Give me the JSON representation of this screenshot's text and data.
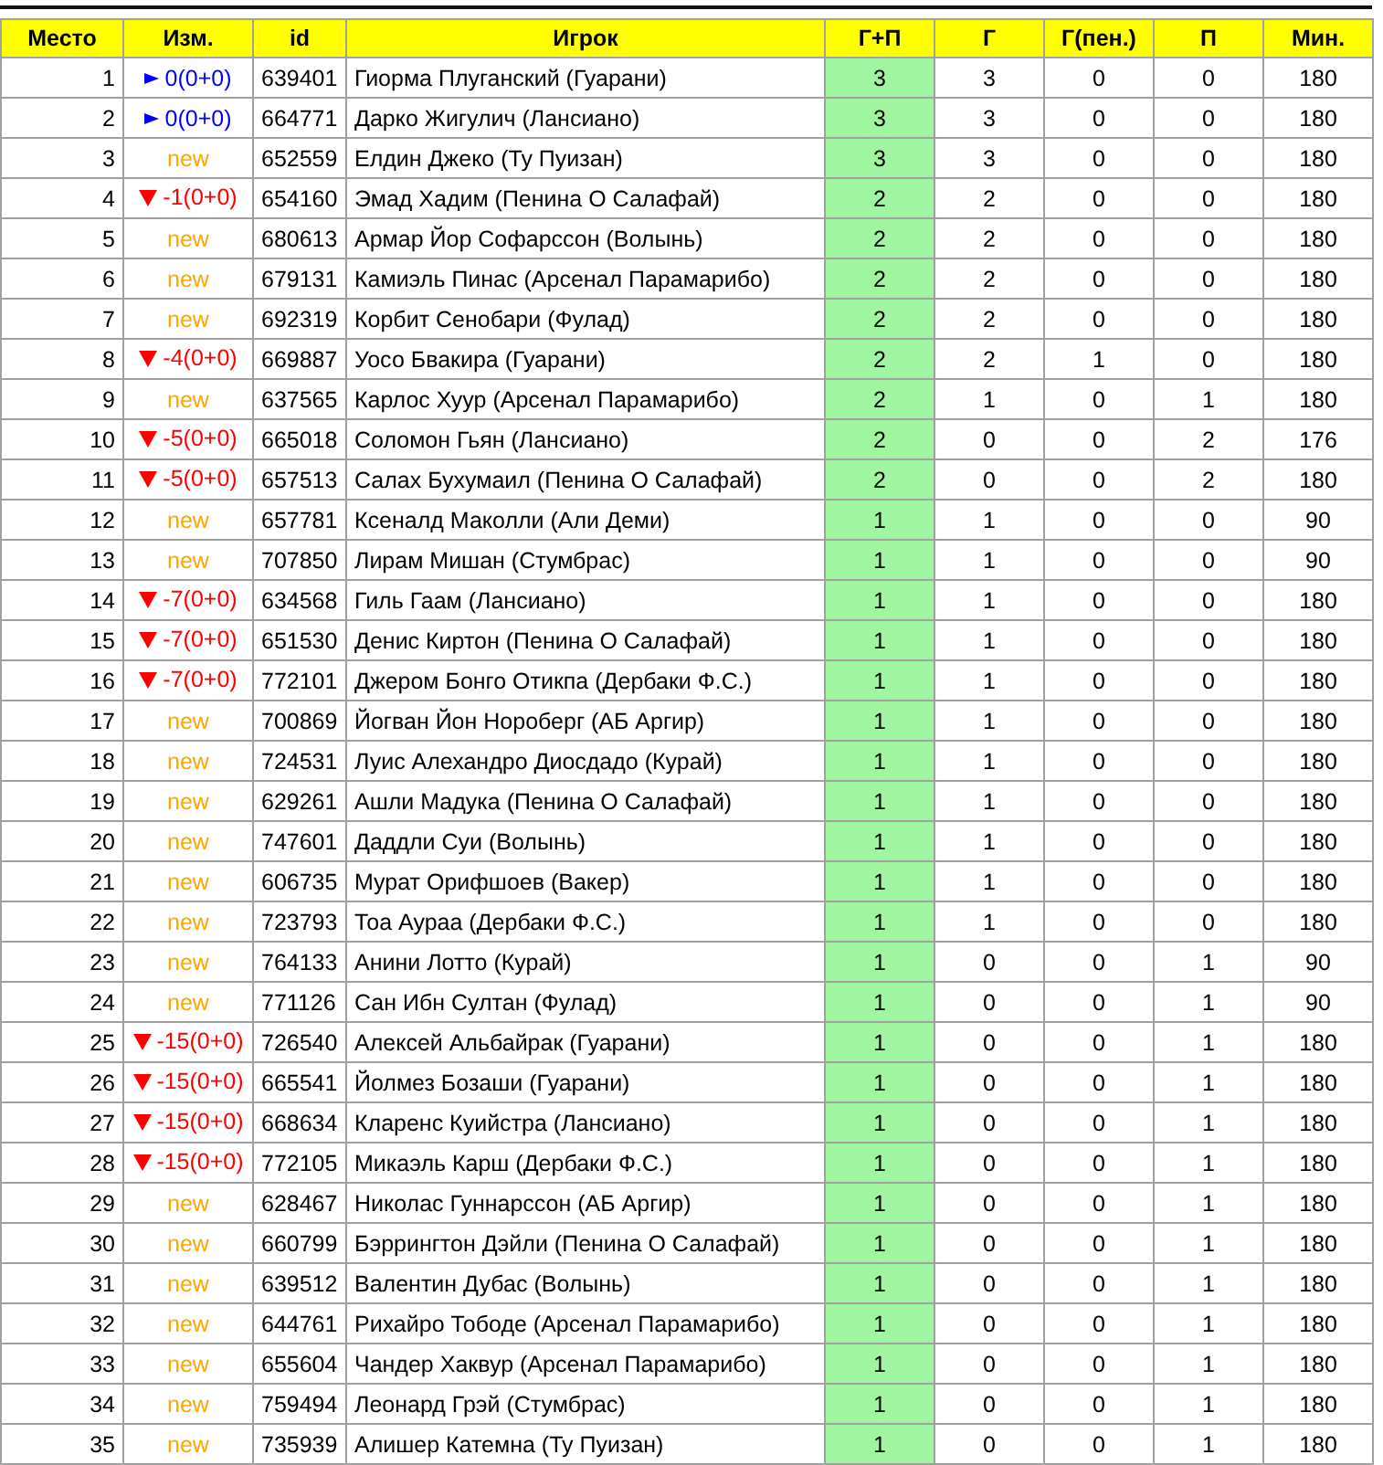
{
  "table": {
    "columns": [
      "Место",
      "Изм.",
      "id",
      "Игрок",
      "Г+П",
      "Г",
      "Г(пен.)",
      "П",
      "Мин."
    ],
    "rows": [
      {
        "place": "1",
        "change": {
          "kind": "same",
          "text": "0(0+0)"
        },
        "id": "639401",
        "player": "Гиорма Плуганский (Гуарани)",
        "gp": "3",
        "g": "3",
        "gpen": "0",
        "p": "0",
        "min": "180"
      },
      {
        "place": "2",
        "change": {
          "kind": "same",
          "text": "0(0+0)"
        },
        "id": "664771",
        "player": "Дарко Жигулич (Лансиано)",
        "gp": "3",
        "g": "3",
        "gpen": "0",
        "p": "0",
        "min": "180"
      },
      {
        "place": "3",
        "change": {
          "kind": "new",
          "text": "new"
        },
        "id": "652559",
        "player": "Елдин Джеко (Ту Пуизан)",
        "gp": "3",
        "g": "3",
        "gpen": "0",
        "p": "0",
        "min": "180"
      },
      {
        "place": "4",
        "change": {
          "kind": "down",
          "text": "-1(0+0)"
        },
        "id": "654160",
        "player": "Эмад Хадим (Пенина О Салафай)",
        "gp": "2",
        "g": "2",
        "gpen": "0",
        "p": "0",
        "min": "180"
      },
      {
        "place": "5",
        "change": {
          "kind": "new",
          "text": "new"
        },
        "id": "680613",
        "player": "Армар Йор Софарссон (Волынь)",
        "gp": "2",
        "g": "2",
        "gpen": "0",
        "p": "0",
        "min": "180"
      },
      {
        "place": "6",
        "change": {
          "kind": "new",
          "text": "new"
        },
        "id": "679131",
        "player": "Камиэль Пинас (Арсенал Парамарибо)",
        "gp": "2",
        "g": "2",
        "gpen": "0",
        "p": "0",
        "min": "180"
      },
      {
        "place": "7",
        "change": {
          "kind": "new",
          "text": "new"
        },
        "id": "692319",
        "player": "Корбит Сенобари (Фулад)",
        "gp": "2",
        "g": "2",
        "gpen": "0",
        "p": "0",
        "min": "180"
      },
      {
        "place": "8",
        "change": {
          "kind": "down",
          "text": "-4(0+0)"
        },
        "id": "669887",
        "player": "Уосо Бвакира (Гуарани)",
        "gp": "2",
        "g": "2",
        "gpen": "1",
        "p": "0",
        "min": "180"
      },
      {
        "place": "9",
        "change": {
          "kind": "new",
          "text": "new"
        },
        "id": "637565",
        "player": "Карлос Хуур (Арсенал Парамарибо)",
        "gp": "2",
        "g": "1",
        "gpen": "0",
        "p": "1",
        "min": "180"
      },
      {
        "place": "10",
        "change": {
          "kind": "down",
          "text": "-5(0+0)"
        },
        "id": "665018",
        "player": "Соломон Гьян (Лансиано)",
        "gp": "2",
        "g": "0",
        "gpen": "0",
        "p": "2",
        "min": "176"
      },
      {
        "place": "11",
        "change": {
          "kind": "down",
          "text": "-5(0+0)"
        },
        "id": "657513",
        "player": "Салах Бухумаил (Пенина О Салафай)",
        "gp": "2",
        "g": "0",
        "gpen": "0",
        "p": "2",
        "min": "180"
      },
      {
        "place": "12",
        "change": {
          "kind": "new",
          "text": "new"
        },
        "id": "657781",
        "player": "Ксеналд Маколли (Али Деми)",
        "gp": "1",
        "g": "1",
        "gpen": "0",
        "p": "0",
        "min": "90"
      },
      {
        "place": "13",
        "change": {
          "kind": "new",
          "text": "new"
        },
        "id": "707850",
        "player": "Лирам Мишан (Стумбрас)",
        "gp": "1",
        "g": "1",
        "gpen": "0",
        "p": "0",
        "min": "90"
      },
      {
        "place": "14",
        "change": {
          "kind": "down",
          "text": "-7(0+0)"
        },
        "id": "634568",
        "player": "Гиль Гаам (Лансиано)",
        "gp": "1",
        "g": "1",
        "gpen": "0",
        "p": "0",
        "min": "180"
      },
      {
        "place": "15",
        "change": {
          "kind": "down",
          "text": "-7(0+0)"
        },
        "id": "651530",
        "player": "Денис Киртон (Пенина О Салафай)",
        "gp": "1",
        "g": "1",
        "gpen": "0",
        "p": "0",
        "min": "180"
      },
      {
        "place": "16",
        "change": {
          "kind": "down",
          "text": "-7(0+0)"
        },
        "id": "772101",
        "player": "Джером Бонго Отикпа (Дербаки Ф.С.)",
        "gp": "1",
        "g": "1",
        "gpen": "0",
        "p": "0",
        "min": "180"
      },
      {
        "place": "17",
        "change": {
          "kind": "new",
          "text": "new"
        },
        "id": "700869",
        "player": "Йогван Йон Нороберг (АБ Аргир)",
        "gp": "1",
        "g": "1",
        "gpen": "0",
        "p": "0",
        "min": "180"
      },
      {
        "place": "18",
        "change": {
          "kind": "new",
          "text": "new"
        },
        "id": "724531",
        "player": "Луис Алехандро Диосдадо (Курай)",
        "gp": "1",
        "g": "1",
        "gpen": "0",
        "p": "0",
        "min": "180"
      },
      {
        "place": "19",
        "change": {
          "kind": "new",
          "text": "new"
        },
        "id": "629261",
        "player": "Ашли Мадука (Пенина О Салафай)",
        "gp": "1",
        "g": "1",
        "gpen": "0",
        "p": "0",
        "min": "180"
      },
      {
        "place": "20",
        "change": {
          "kind": "new",
          "text": "new"
        },
        "id": "747601",
        "player": "Даддли Суи (Волынь)",
        "gp": "1",
        "g": "1",
        "gpen": "0",
        "p": "0",
        "min": "180"
      },
      {
        "place": "21",
        "change": {
          "kind": "new",
          "text": "new"
        },
        "id": "606735",
        "player": "Мурат Орифшоев (Вакер)",
        "gp": "1",
        "g": "1",
        "gpen": "0",
        "p": "0",
        "min": "180"
      },
      {
        "place": "22",
        "change": {
          "kind": "new",
          "text": "new"
        },
        "id": "723793",
        "player": "Тоа Аураа (Дербаки Ф.С.)",
        "gp": "1",
        "g": "1",
        "gpen": "0",
        "p": "0",
        "min": "180"
      },
      {
        "place": "23",
        "change": {
          "kind": "new",
          "text": "new"
        },
        "id": "764133",
        "player": "Анини Лотто (Курай)",
        "gp": "1",
        "g": "0",
        "gpen": "0",
        "p": "1",
        "min": "90"
      },
      {
        "place": "24",
        "change": {
          "kind": "new",
          "text": "new"
        },
        "id": "771126",
        "player": "Сан Ибн Султан (Фулад)",
        "gp": "1",
        "g": "0",
        "gpen": "0",
        "p": "1",
        "min": "90"
      },
      {
        "place": "25",
        "change": {
          "kind": "down",
          "text": "-15(0+0)"
        },
        "id": "726540",
        "player": "Алексей Альбайрак (Гуарани)",
        "gp": "1",
        "g": "0",
        "gpen": "0",
        "p": "1",
        "min": "180"
      },
      {
        "place": "26",
        "change": {
          "kind": "down",
          "text": "-15(0+0)"
        },
        "id": "665541",
        "player": "Йолмез Бозаши (Гуарани)",
        "gp": "1",
        "g": "0",
        "gpen": "0",
        "p": "1",
        "min": "180"
      },
      {
        "place": "27",
        "change": {
          "kind": "down",
          "text": "-15(0+0)"
        },
        "id": "668634",
        "player": "Кларенс Куийстра (Лансиано)",
        "gp": "1",
        "g": "0",
        "gpen": "0",
        "p": "1",
        "min": "180"
      },
      {
        "place": "28",
        "change": {
          "kind": "down",
          "text": "-15(0+0)"
        },
        "id": "772105",
        "player": "Микаэль Карш (Дербаки Ф.С.)",
        "gp": "1",
        "g": "0",
        "gpen": "0",
        "p": "1",
        "min": "180"
      },
      {
        "place": "29",
        "change": {
          "kind": "new",
          "text": "new"
        },
        "id": "628467",
        "player": "Николас Гуннарссон (АБ Аргир)",
        "gp": "1",
        "g": "0",
        "gpen": "0",
        "p": "1",
        "min": "180"
      },
      {
        "place": "30",
        "change": {
          "kind": "new",
          "text": "new"
        },
        "id": "660799",
        "player": "Бэррингтон Дэйли (Пенина О Салафай)",
        "gp": "1",
        "g": "0",
        "gpen": "0",
        "p": "1",
        "min": "180"
      },
      {
        "place": "31",
        "change": {
          "kind": "new",
          "text": "new"
        },
        "id": "639512",
        "player": "Валентин Дубас (Волынь)",
        "gp": "1",
        "g": "0",
        "gpen": "0",
        "p": "1",
        "min": "180"
      },
      {
        "place": "32",
        "change": {
          "kind": "new",
          "text": "new"
        },
        "id": "644761",
        "player": "Рихайро Тободе (Арсенал Парамарибо)",
        "gp": "1",
        "g": "0",
        "gpen": "0",
        "p": "1",
        "min": "180"
      },
      {
        "place": "33",
        "change": {
          "kind": "new",
          "text": "new"
        },
        "id": "655604",
        "player": "Чандер Хаквур (Арсенал Парамарибо)",
        "gp": "1",
        "g": "0",
        "gpen": "0",
        "p": "1",
        "min": "180"
      },
      {
        "place": "34",
        "change": {
          "kind": "new",
          "text": "new"
        },
        "id": "759494",
        "player": "Леонард Грэй (Стумбрас)",
        "gp": "1",
        "g": "0",
        "gpen": "0",
        "p": "1",
        "min": "180"
      },
      {
        "place": "35",
        "change": {
          "kind": "new",
          "text": "new"
        },
        "id": "735939",
        "player": "Алишер Катемна (Ту Пуизан)",
        "gp": "1",
        "g": "0",
        "gpen": "0",
        "p": "1",
        "min": "180"
      }
    ]
  }
}
